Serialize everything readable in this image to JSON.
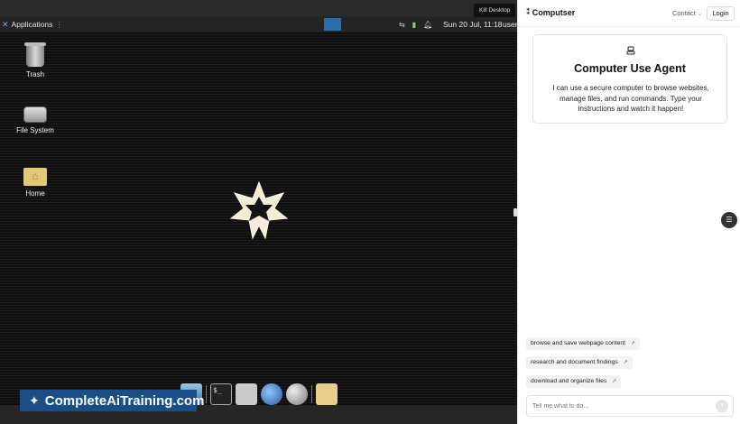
{
  "desktop": {
    "tooltip": "Kill Desktop",
    "panel": {
      "apps_label": "Applications",
      "clock": "Sun 20 Jul, 11:18",
      "user": "user"
    },
    "icons": [
      {
        "label": "Trash",
        "icon": "trash-icon"
      },
      {
        "label": "File System",
        "icon": "drive-icon"
      },
      {
        "label": "Home",
        "icon": "home-folder-icon"
      }
    ],
    "terminal_prompt": "$_",
    "banner": "CompleteAiTraining.com"
  },
  "panel": {
    "brand": "Computser",
    "contact": "Contact",
    "login": "Login",
    "intro": {
      "title": "Computer Use Agent",
      "text": "I can use a secure computer to browse websites, manage files, and run commands. Type your instructions and watch it happen!"
    },
    "suggestions": [
      "browse and save webpage content",
      "research and document findings",
      "download and organize files"
    ],
    "input_placeholder": "Tell me what to do..."
  },
  "colors": {
    "banner": "#1b4e86",
    "workspace": "#2f6cae",
    "panel_bg": "#ffffff"
  }
}
